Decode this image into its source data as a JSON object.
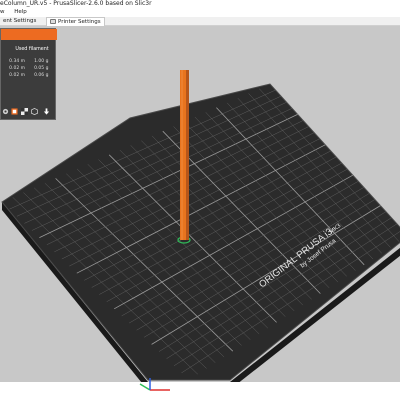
{
  "window": {
    "title": "eColumn_UR.v5 - PrusaSlicer-2.6.0 based on Slic3r"
  },
  "menu": {
    "items": [
      "w",
      "Help"
    ]
  },
  "tabs": [
    {
      "label": "ent Settings",
      "active": false
    },
    {
      "label": "Printer Settings",
      "active": true
    }
  ],
  "legend": {
    "header": "Used filament",
    "rows": [
      {
        "length": "0.34 m",
        "weight": "1.00 g"
      },
      {
        "length": "0.02 m",
        "weight": "0.05 g"
      },
      {
        "length": "0.02 m",
        "weight": "0.06 g"
      }
    ],
    "accent_color": "#ed6b21",
    "background_color": "#3c3c3c"
  },
  "bed": {
    "brand_line": "ORIGINAL PRUSA i3",
    "model": "MK3",
    "maker": "by Josef Prusa",
    "surface_color": "#2a2a2a",
    "grid_color": "#6a6a6a"
  },
  "object": {
    "color": "#e8741e"
  },
  "axes_icons": [
    "x-axis-icon",
    "y-axis-icon",
    "z-axis-icon"
  ]
}
